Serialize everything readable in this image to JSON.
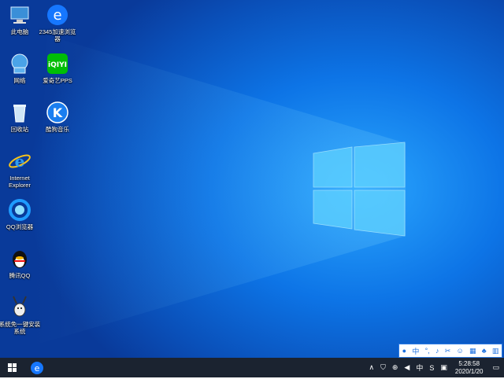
{
  "desktop_icons": [
    {
      "label": "此电脑",
      "icon": "computer-icon"
    },
    {
      "label": "2345加速浏览器",
      "icon": "browser-2345-icon"
    },
    {
      "label": "网络",
      "icon": "network-icon"
    },
    {
      "label": "爱奇艺PPS",
      "icon": "iqiyi-icon"
    },
    {
      "label": "回收站",
      "icon": "recycle-bin-icon"
    },
    {
      "label": "酷狗音乐",
      "icon": "kugou-icon"
    },
    {
      "label": "Internet Explorer",
      "icon": "ie-icon"
    },
    {
      "label": "QQ浏览器",
      "icon": "qq-browser-icon"
    },
    {
      "label": "腾讯QQ",
      "icon": "qq-icon"
    },
    {
      "label": "系统免一键安装系统",
      "icon": "installer-icon"
    }
  ],
  "taskbar": {
    "ime_indicator": "中",
    "clock_time": "5:28:58",
    "clock_date": "2020/1/20"
  },
  "ime_toolbar": {
    "lang": "中",
    "punct": "°,"
  }
}
